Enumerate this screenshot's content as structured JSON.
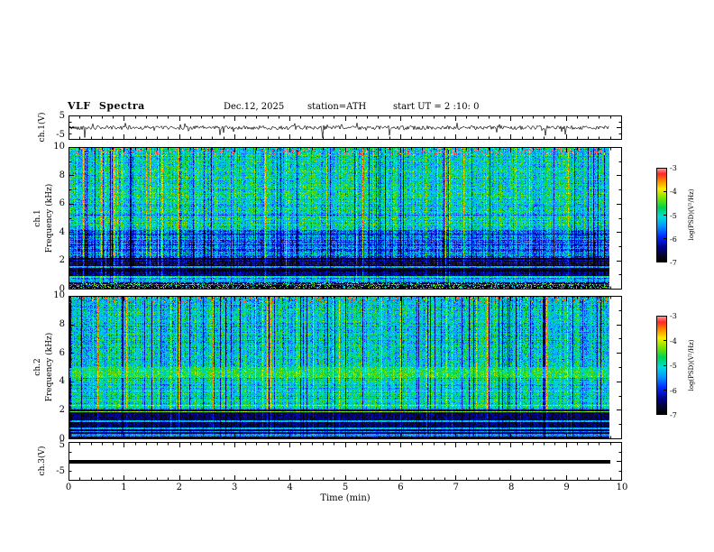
{
  "header": {
    "title": "VLF  Spectra",
    "date": "Dec.12, 2025",
    "station": "station=ATH",
    "start_ut": "start UT =  2 :10: 0"
  },
  "xaxis": {
    "label": "Time (min)",
    "ticks": [
      "0",
      "1",
      "2",
      "3",
      "4",
      "5",
      "6",
      "7",
      "8",
      "9",
      "10"
    ]
  },
  "panels": {
    "ch1_wave": {
      "ylabel": "ch.1(V)",
      "ytop": "5",
      "ybottom": "-5"
    },
    "ch1_spec": {
      "channel": "ch.1",
      "ylabel": "Frequency (kHz)",
      "yticks": [
        "10",
        "8",
        "6",
        "4",
        "2",
        "0"
      ]
    },
    "ch2_spec": {
      "channel": "ch.2",
      "ylabel": "Frequency (kHz)",
      "yticks": [
        "10",
        "8",
        "6",
        "4",
        "2",
        "0"
      ]
    },
    "ch3_wave": {
      "ylabel": "ch.3(V)",
      "ytop": "5",
      "ybottom": "-5"
    }
  },
  "colorbar": {
    "label": "log(PSD)(V²/Hz)",
    "ticks": [
      "-3",
      "-4",
      "-5",
      "-6",
      "-7"
    ]
  },
  "chart_data": [
    {
      "type": "line",
      "panel": "ch.1(V) time series",
      "xlabel": "Time (min)",
      "xlim": [
        0,
        10
      ],
      "ylim": [
        -5,
        5
      ],
      "series": [
        {
          "name": "ch.1 voltage",
          "summary": "broadband noise of roughly ±0.5 V about 0 V with many impulsive sferic spikes reaching toward ±5 V, data extend from 0 to about 9.8 min"
        }
      ]
    },
    {
      "type": "heatmap",
      "panel": "ch.1 spectrogram",
      "xlabel": "Time (min)",
      "ylabel": "Frequency (kHz)",
      "xlim": [
        0,
        10
      ],
      "ylim": [
        0,
        10
      ],
      "zlabel": "log(PSD)(V²/Hz)",
      "zlim": [
        -7,
        -3
      ],
      "summary": "green broadband noise (~-4.5) above 4 kHz crossed by dense vertical sferic streaks; blue band (~-6) from 2 to 4 kHz; dark horizontally banded region below 2 kHz with bright narrowband lines near 2.5, 1.6 and 0.9 kHz; near-black band (~-7) below 0.4 kHz; data end at ~9.8 min"
    },
    {
      "type": "heatmap",
      "panel": "ch.2 spectrogram",
      "xlabel": "Time (min)",
      "ylabel": "Frequency (kHz)",
      "xlim": [
        0,
        10
      ],
      "ylim": [
        0,
        10
      ],
      "zlabel": "log(PSD)(V²/Hz)",
      "zlim": [
        -7,
        -3
      ],
      "summary": "green-cyan noise above 5 kHz with vertical sferic streaks; bright yellow-green band 4.3-5 kHz; orange narrowband interference line near 3.4 kHz; strong alternating yellow/dark horizontal striping below 2 kHz; near-black band at lowest frequencies; data end at ~9.8 min"
    },
    {
      "type": "line",
      "panel": "ch.3(V) time series",
      "xlabel": "Time (min)",
      "xlim": [
        0,
        10
      ],
      "ylim": [
        -5,
        5
      ],
      "series": [
        {
          "name": "ch.3 voltage",
          "summary": "constant flat signal at 0 V (thick black line) from 0 to about 9.8 min"
        }
      ]
    }
  ]
}
